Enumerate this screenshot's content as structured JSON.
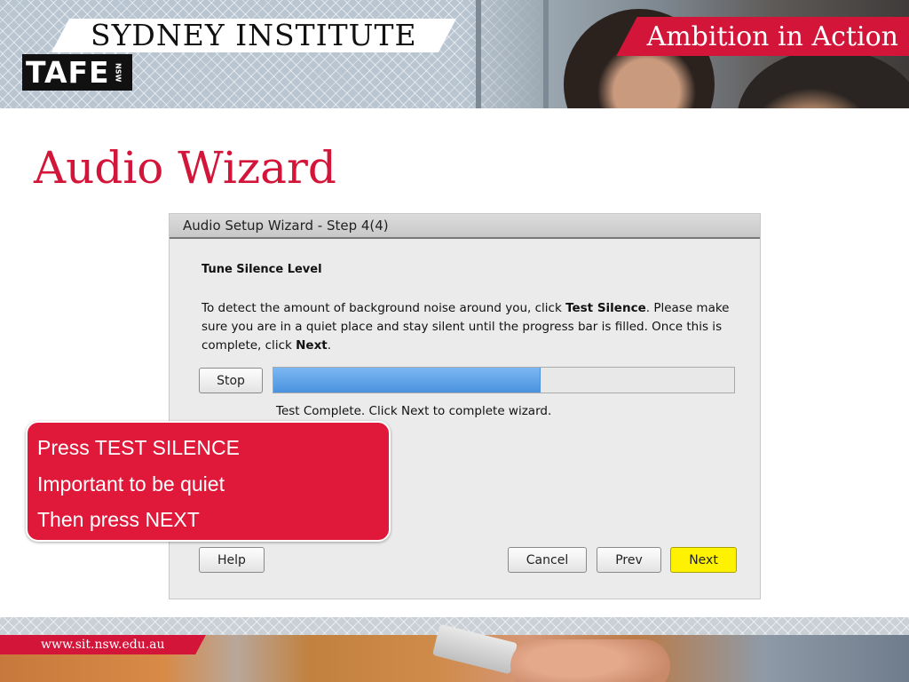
{
  "header": {
    "institute": "SYDNEY INSTITUTE",
    "logo_text": "TAFE",
    "logo_sub": "NSW",
    "tagline": "Ambition in Action"
  },
  "slide": {
    "title": "Audio Wizard"
  },
  "wizard": {
    "window_title": "Audio Setup Wizard - Step 4(4)",
    "step_heading": "Tune Silence Level",
    "body_text_1": "To detect the amount of background noise around you, click ",
    "body_bold_1": "Test Silence",
    "body_text_2": ". Please make sure you are in a quiet place and stay silent until the progress bar is filled. Once this is complete, click ",
    "body_bold_2": "Next",
    "body_text_3": ".",
    "stop_label": "Stop",
    "progress_fraction": 0.58,
    "status_text": "Test Complete. Click Next to complete wizard.",
    "help_label": "Help",
    "cancel_label": "Cancel",
    "prev_label": "Prev",
    "next_label": "Next",
    "next_highlight_color": "#fff200"
  },
  "callout": {
    "lines": [
      "Press TEST SILENCE",
      "Important to be quiet",
      "Then press NEXT"
    ],
    "color": "#e0193a"
  },
  "footer": {
    "url": "www.sit.nsw.edu.au"
  },
  "theme": {
    "brand_red": "#d3153a"
  }
}
